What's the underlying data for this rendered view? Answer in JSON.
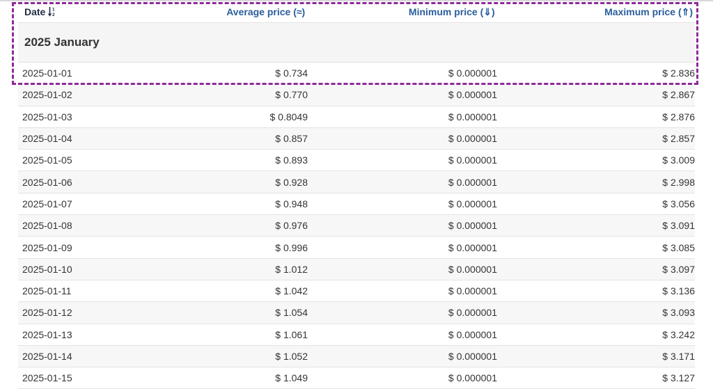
{
  "table": {
    "headers": {
      "date": "Date",
      "average": "Average price (≈)",
      "minimum": "Minimum price (⇓)",
      "maximum": "Maximum price (⇑)"
    },
    "group_label": "2025 January",
    "rows": [
      {
        "date": "2025-01-01",
        "avg": "$ 0.734",
        "min": "$ 0.000001",
        "max": "$ 2.836"
      },
      {
        "date": "2025-01-02",
        "avg": "$ 0.770",
        "min": "$ 0.000001",
        "max": "$ 2.867"
      },
      {
        "date": "2025-01-03",
        "avg": "$ 0.8049",
        "min": "$ 0.000001",
        "max": "$ 2.876"
      },
      {
        "date": "2025-01-04",
        "avg": "$ 0.857",
        "min": "$ 0.000001",
        "max": "$ 2.857"
      },
      {
        "date": "2025-01-05",
        "avg": "$ 0.893",
        "min": "$ 0.000001",
        "max": "$ 3.009"
      },
      {
        "date": "2025-01-06",
        "avg": "$ 0.928",
        "min": "$ 0.000001",
        "max": "$ 2.998"
      },
      {
        "date": "2025-01-07",
        "avg": "$ 0.948",
        "min": "$ 0.000001",
        "max": "$ 3.056"
      },
      {
        "date": "2025-01-08",
        "avg": "$ 0.976",
        "min": "$ 0.000001",
        "max": "$ 3.091"
      },
      {
        "date": "2025-01-09",
        "avg": "$ 0.996",
        "min": "$ 0.000001",
        "max": "$ 3.085"
      },
      {
        "date": "2025-01-10",
        "avg": "$ 1.012",
        "min": "$ 0.000001",
        "max": "$ 3.097"
      },
      {
        "date": "2025-01-11",
        "avg": "$ 1.042",
        "min": "$ 0.000001",
        "max": "$ 3.136"
      },
      {
        "date": "2025-01-12",
        "avg": "$ 1.054",
        "min": "$ 0.000001",
        "max": "$ 3.093"
      },
      {
        "date": "2025-01-13",
        "avg": "$ 1.061",
        "min": "$ 0.000001",
        "max": "$ 3.242"
      },
      {
        "date": "2025-01-14",
        "avg": "$ 1.052",
        "min": "$ 0.000001",
        "max": "$ 3.171"
      },
      {
        "date": "2025-01-15",
        "avg": "$ 1.049",
        "min": "$ 0.000001",
        "max": "$ 3.127"
      }
    ]
  },
  "icons": {
    "date_sort": "sort-ascending-icon"
  },
  "colors": {
    "header_link": "#2a5d9c",
    "highlight": "#8e2a9a",
    "group_bg": "#f5f5f5"
  }
}
